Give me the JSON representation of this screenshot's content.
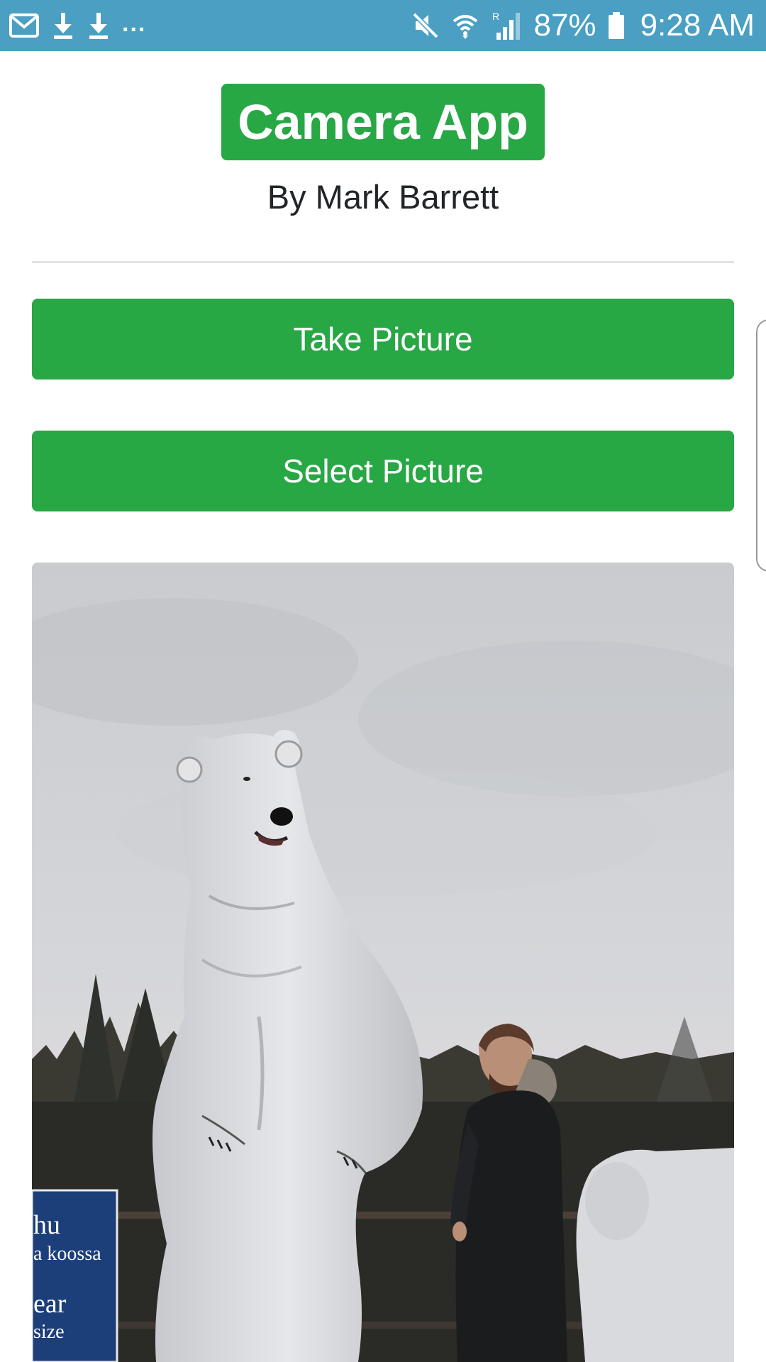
{
  "status_bar": {
    "left_icons": [
      "mail-icon",
      "download-icon",
      "download-icon",
      "more-notifications-icon"
    ],
    "more_text": "...",
    "right_icons": [
      "mute-icon",
      "wifi-icon",
      "signal-icon",
      "battery-icon"
    ],
    "roaming_label": "R",
    "battery_percent": "87%",
    "time": "9:28 AM",
    "background_color": "#4a9fc3"
  },
  "header": {
    "title": "Camera App",
    "author": "By Mark Barrett"
  },
  "buttons": {
    "take_picture": "Take Picture",
    "select_picture": "Select Picture"
  },
  "photo": {
    "subject": "person-with-polar-bear-cutout",
    "sign_lines": [
      "hu",
      "a koossa",
      "ear",
      "size"
    ]
  },
  "colors": {
    "accent": "#28a745",
    "text": "#212529"
  }
}
